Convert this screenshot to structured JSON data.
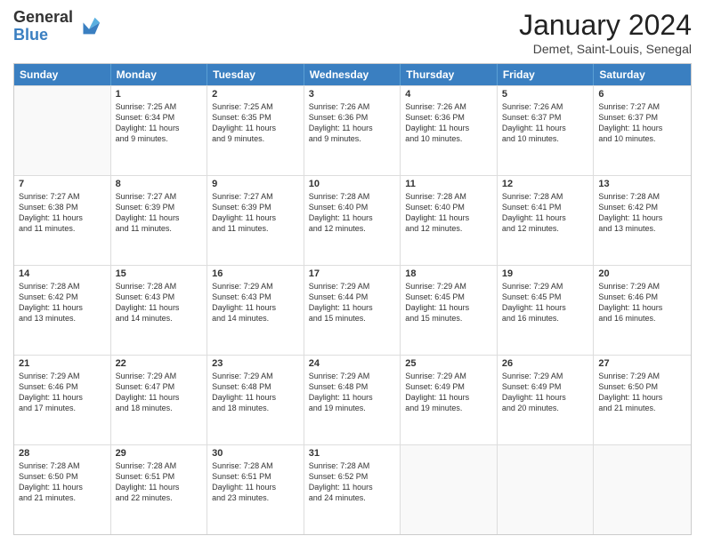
{
  "logo": {
    "general": "General",
    "blue": "Blue"
  },
  "title": "January 2024",
  "location": "Demet, Saint-Louis, Senegal",
  "days": [
    "Sunday",
    "Monday",
    "Tuesday",
    "Wednesday",
    "Thursday",
    "Friday",
    "Saturday"
  ],
  "weeks": [
    [
      {
        "num": "",
        "lines": []
      },
      {
        "num": "1",
        "lines": [
          "Sunrise: 7:25 AM",
          "Sunset: 6:34 PM",
          "Daylight: 11 hours",
          "and 9 minutes."
        ]
      },
      {
        "num": "2",
        "lines": [
          "Sunrise: 7:25 AM",
          "Sunset: 6:35 PM",
          "Daylight: 11 hours",
          "and 9 minutes."
        ]
      },
      {
        "num": "3",
        "lines": [
          "Sunrise: 7:26 AM",
          "Sunset: 6:36 PM",
          "Daylight: 11 hours",
          "and 9 minutes."
        ]
      },
      {
        "num": "4",
        "lines": [
          "Sunrise: 7:26 AM",
          "Sunset: 6:36 PM",
          "Daylight: 11 hours",
          "and 10 minutes."
        ]
      },
      {
        "num": "5",
        "lines": [
          "Sunrise: 7:26 AM",
          "Sunset: 6:37 PM",
          "Daylight: 11 hours",
          "and 10 minutes."
        ]
      },
      {
        "num": "6",
        "lines": [
          "Sunrise: 7:27 AM",
          "Sunset: 6:37 PM",
          "Daylight: 11 hours",
          "and 10 minutes."
        ]
      }
    ],
    [
      {
        "num": "7",
        "lines": [
          "Sunrise: 7:27 AM",
          "Sunset: 6:38 PM",
          "Daylight: 11 hours",
          "and 11 minutes."
        ]
      },
      {
        "num": "8",
        "lines": [
          "Sunrise: 7:27 AM",
          "Sunset: 6:39 PM",
          "Daylight: 11 hours",
          "and 11 minutes."
        ]
      },
      {
        "num": "9",
        "lines": [
          "Sunrise: 7:27 AM",
          "Sunset: 6:39 PM",
          "Daylight: 11 hours",
          "and 11 minutes."
        ]
      },
      {
        "num": "10",
        "lines": [
          "Sunrise: 7:28 AM",
          "Sunset: 6:40 PM",
          "Daylight: 11 hours",
          "and 12 minutes."
        ]
      },
      {
        "num": "11",
        "lines": [
          "Sunrise: 7:28 AM",
          "Sunset: 6:40 PM",
          "Daylight: 11 hours",
          "and 12 minutes."
        ]
      },
      {
        "num": "12",
        "lines": [
          "Sunrise: 7:28 AM",
          "Sunset: 6:41 PM",
          "Daylight: 11 hours",
          "and 12 minutes."
        ]
      },
      {
        "num": "13",
        "lines": [
          "Sunrise: 7:28 AM",
          "Sunset: 6:42 PM",
          "Daylight: 11 hours",
          "and 13 minutes."
        ]
      }
    ],
    [
      {
        "num": "14",
        "lines": [
          "Sunrise: 7:28 AM",
          "Sunset: 6:42 PM",
          "Daylight: 11 hours",
          "and 13 minutes."
        ]
      },
      {
        "num": "15",
        "lines": [
          "Sunrise: 7:28 AM",
          "Sunset: 6:43 PM",
          "Daylight: 11 hours",
          "and 14 minutes."
        ]
      },
      {
        "num": "16",
        "lines": [
          "Sunrise: 7:29 AM",
          "Sunset: 6:43 PM",
          "Daylight: 11 hours",
          "and 14 minutes."
        ]
      },
      {
        "num": "17",
        "lines": [
          "Sunrise: 7:29 AM",
          "Sunset: 6:44 PM",
          "Daylight: 11 hours",
          "and 15 minutes."
        ]
      },
      {
        "num": "18",
        "lines": [
          "Sunrise: 7:29 AM",
          "Sunset: 6:45 PM",
          "Daylight: 11 hours",
          "and 15 minutes."
        ]
      },
      {
        "num": "19",
        "lines": [
          "Sunrise: 7:29 AM",
          "Sunset: 6:45 PM",
          "Daylight: 11 hours",
          "and 16 minutes."
        ]
      },
      {
        "num": "20",
        "lines": [
          "Sunrise: 7:29 AM",
          "Sunset: 6:46 PM",
          "Daylight: 11 hours",
          "and 16 minutes."
        ]
      }
    ],
    [
      {
        "num": "21",
        "lines": [
          "Sunrise: 7:29 AM",
          "Sunset: 6:46 PM",
          "Daylight: 11 hours",
          "and 17 minutes."
        ]
      },
      {
        "num": "22",
        "lines": [
          "Sunrise: 7:29 AM",
          "Sunset: 6:47 PM",
          "Daylight: 11 hours",
          "and 18 minutes."
        ]
      },
      {
        "num": "23",
        "lines": [
          "Sunrise: 7:29 AM",
          "Sunset: 6:48 PM",
          "Daylight: 11 hours",
          "and 18 minutes."
        ]
      },
      {
        "num": "24",
        "lines": [
          "Sunrise: 7:29 AM",
          "Sunset: 6:48 PM",
          "Daylight: 11 hours",
          "and 19 minutes."
        ]
      },
      {
        "num": "25",
        "lines": [
          "Sunrise: 7:29 AM",
          "Sunset: 6:49 PM",
          "Daylight: 11 hours",
          "and 19 minutes."
        ]
      },
      {
        "num": "26",
        "lines": [
          "Sunrise: 7:29 AM",
          "Sunset: 6:49 PM",
          "Daylight: 11 hours",
          "and 20 minutes."
        ]
      },
      {
        "num": "27",
        "lines": [
          "Sunrise: 7:29 AM",
          "Sunset: 6:50 PM",
          "Daylight: 11 hours",
          "and 21 minutes."
        ]
      }
    ],
    [
      {
        "num": "28",
        "lines": [
          "Sunrise: 7:28 AM",
          "Sunset: 6:50 PM",
          "Daylight: 11 hours",
          "and 21 minutes."
        ]
      },
      {
        "num": "29",
        "lines": [
          "Sunrise: 7:28 AM",
          "Sunset: 6:51 PM",
          "Daylight: 11 hours",
          "and 22 minutes."
        ]
      },
      {
        "num": "30",
        "lines": [
          "Sunrise: 7:28 AM",
          "Sunset: 6:51 PM",
          "Daylight: 11 hours",
          "and 23 minutes."
        ]
      },
      {
        "num": "31",
        "lines": [
          "Sunrise: 7:28 AM",
          "Sunset: 6:52 PM",
          "Daylight: 11 hours",
          "and 24 minutes."
        ]
      },
      {
        "num": "",
        "lines": []
      },
      {
        "num": "",
        "lines": []
      },
      {
        "num": "",
        "lines": []
      }
    ]
  ]
}
